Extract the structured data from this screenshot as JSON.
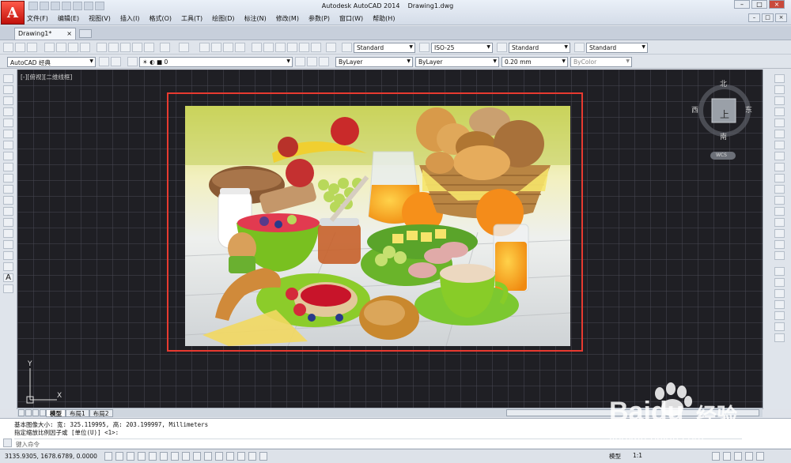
{
  "window": {
    "title": "Autodesk AutoCAD 2014",
    "document": "Drawing1.dwg",
    "controls": [
      "–",
      "□",
      "×"
    ],
    "doc_controls": [
      "–",
      "□",
      "×"
    ]
  },
  "menu": [
    "文件(F)",
    "编辑(E)",
    "视图(V)",
    "插入(I)",
    "格式(O)",
    "工具(T)",
    "绘图(D)",
    "标注(N)",
    "修改(M)",
    "参数(P)",
    "窗口(W)",
    "帮助(H)"
  ],
  "tabs": {
    "active": "Drawing1*",
    "close": "×"
  },
  "toolbar1": {
    "text_style": "Standard",
    "dim_style": "ISO-25",
    "table_style": "Standard",
    "mleader_style": "Standard"
  },
  "toolbar2": {
    "workspace": "AutoCAD 经典",
    "layer": "0",
    "color": "ByLayer",
    "linetype": "ByLayer",
    "lineweight": "0.20 mm",
    "plotstyle": "ByColor"
  },
  "viewport": {
    "label": "[-][俯视][二维线框]",
    "compass": {
      "north": "北",
      "south": "南",
      "east": "东",
      "west": "西",
      "top": "上",
      "wcs": "WCS"
    },
    "ucs": {
      "x": "X",
      "y": "Y"
    }
  },
  "layout_tabs": [
    "模型",
    "布局1",
    "布局2"
  ],
  "command": {
    "line1": "基本图像大小: 宽: 325.119995, 高: 203.199997, Millimeters",
    "line2": "指定缩放比例因子或 [单位(U)] <1>:",
    "placeholder": "键入命令"
  },
  "status": {
    "coords": "3135.9305, 1678.6789, 0.0000",
    "model": "模型",
    "anno_scale": "1:1"
  },
  "watermark": {
    "brand": "Baidu",
    "cn": "经验",
    "url": "jingyan.baidu.com"
  },
  "colors": {
    "selection": "#e83a30",
    "viewport_bg": "#1f1f24"
  }
}
